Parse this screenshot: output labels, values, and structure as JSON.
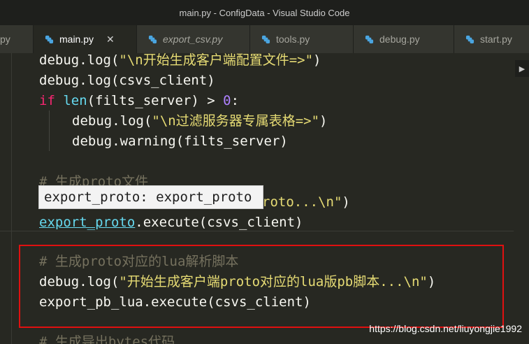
{
  "window": {
    "title": "main.py - ConfigData - Visual Studio Code"
  },
  "tabs": [
    {
      "label": "py"
    },
    {
      "label": "main.py"
    },
    {
      "label": "export_csv.py"
    },
    {
      "label": "tools.py"
    },
    {
      "label": "debug.py"
    },
    {
      "label": "start.py"
    }
  ],
  "icons": {
    "python": "python-file-icon",
    "close": "close-icon",
    "scroll": "scroll-right-icon"
  },
  "colors": {
    "highlight": "#e01010",
    "python_icon": "#4aa5e0"
  },
  "code": {
    "l1": {
      "a": "debug.log(",
      "s": "\"\\n开始生成客户端配置文件=>\"",
      "b": ")"
    },
    "l2": {
      "a": "debug.log(csvs_client)"
    },
    "l3": {
      "kw": "if",
      "fn": "len",
      "a": "(filts_server) > ",
      "num": "0",
      "b": ":"
    },
    "l4": {
      "a": "debug.log(",
      "s": "\"\\n过滤服务器专属表格=>\"",
      "b": ")"
    },
    "l5": {
      "a": "debug.warning(filts_server)"
    },
    "l7": {
      "c": "# 生成proto文件"
    },
    "l8": {
      "s": "roto...\\n\"",
      "b": ")"
    },
    "l9": {
      "u": "export_proto",
      "a": ".execute(csvs_client)"
    },
    "l11": {
      "c": "# 生成proto对应的lua解析脚本"
    },
    "l12": {
      "a": "debug.log(",
      "s": "\"开始生成客户端proto对应的lua版pb脚本...\\n\"",
      "b": ")"
    },
    "l13": {
      "a": "export_pb_lua.execute(csvs_client)"
    },
    "l15": {
      "c": "# 生成导出bytes代码"
    }
  },
  "hover": {
    "text": "export_proto: export_proto"
  },
  "watermark": "https://blog.csdn.net/liuyongjie1992"
}
